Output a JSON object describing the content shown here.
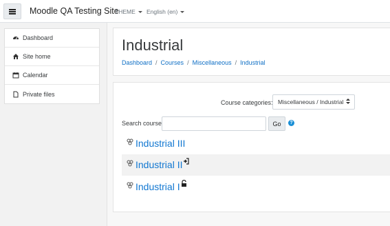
{
  "navbar": {
    "site_name": "Moodle QA Testing Site",
    "theme_menu": "THEME",
    "language_menu": "English (en)"
  },
  "drawer": {
    "items": [
      {
        "label": "Dashboard",
        "icon": "dashboard-icon"
      },
      {
        "label": "Site home",
        "icon": "home-icon"
      },
      {
        "label": "Calendar",
        "icon": "calendar-icon"
      },
      {
        "label": "Private files",
        "icon": "file-icon"
      }
    ]
  },
  "header": {
    "title": "Industrial",
    "breadcrumb": [
      "Dashboard",
      "Courses",
      "Miscellaneous",
      "Industrial"
    ]
  },
  "category_select": {
    "label": "Course categories:",
    "selected": "Miscellaneous / Industrial"
  },
  "search": {
    "label": "Search courses",
    "value": "",
    "button_label": "Go",
    "help_glyph": "?"
  },
  "courses": [
    {
      "name": "Industrial III",
      "icon": "course-icon",
      "meta_icon": ""
    },
    {
      "name": "Industrial II",
      "icon": "course-icon",
      "meta_icon": "enrol-icon"
    },
    {
      "name": "Industrial I",
      "icon": "course-icon",
      "meta_icon": "unlock-icon"
    }
  ],
  "colors": {
    "link": "#1177d1",
    "breadcrumb_link": "#0f6fc5",
    "help": "#1a8fd6"
  }
}
